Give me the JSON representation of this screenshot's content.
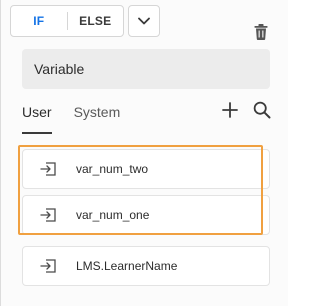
{
  "condition_toggle": {
    "if_label": "IF",
    "else_label": "ELSE",
    "active_color": "#1473e6"
  },
  "icons": {
    "dropdown": "chevron-down-icon",
    "delete": "trash-icon",
    "add": "plus-icon",
    "search": "search-icon",
    "variable": "variable-insert-icon"
  },
  "header": {
    "title": "Variable"
  },
  "tabs": [
    {
      "label": "User",
      "active": true
    },
    {
      "label": "System",
      "active": false
    }
  ],
  "variables": [
    {
      "name": "var_num_two",
      "highlighted": true
    },
    {
      "name": "var_num_one",
      "highlighted": true
    },
    {
      "name": "LMS.LearnerName",
      "highlighted": false
    }
  ],
  "highlight_color": "#f0a040"
}
